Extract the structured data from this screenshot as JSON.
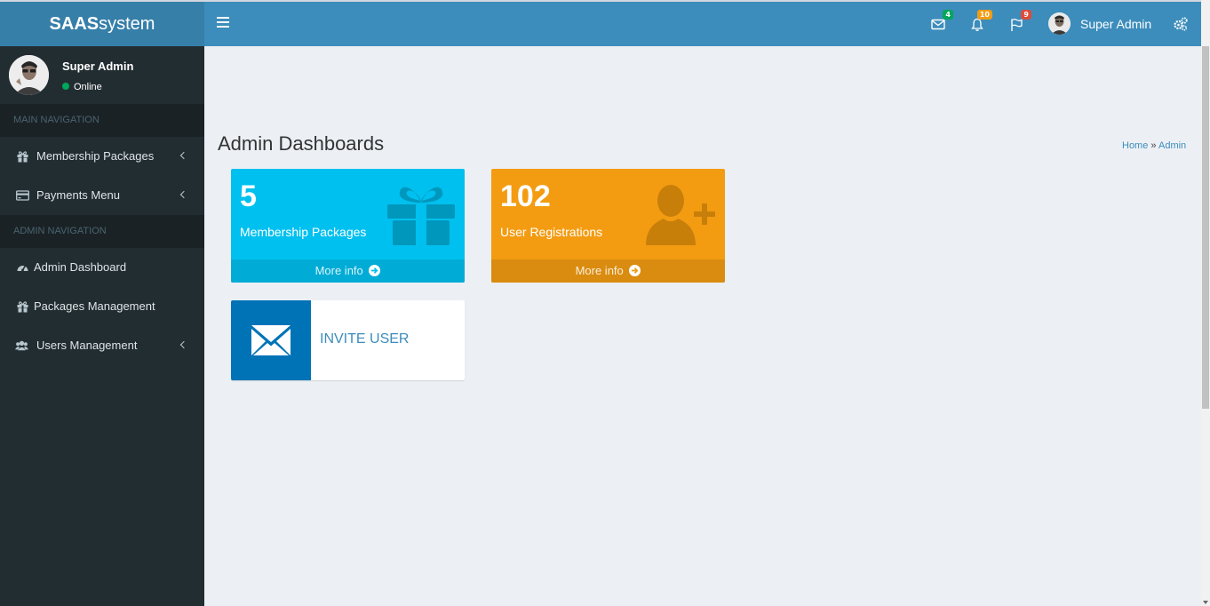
{
  "brand": {
    "bold": "SAAS",
    "rest": "system"
  },
  "navbar": {
    "notifications": [
      {
        "icon": "envelope-icon",
        "count": "4",
        "color": "#00a65a"
      },
      {
        "icon": "bell-icon",
        "count": "10",
        "color": "#f39c12"
      },
      {
        "icon": "flag-icon",
        "count": "9",
        "color": "#dd4b39"
      }
    ],
    "user_name": "Super Admin"
  },
  "sidebar": {
    "user": {
      "name": "Super Admin",
      "status": "Online"
    },
    "sections": [
      {
        "header": "MAIN NAVIGATION",
        "items": [
          {
            "icon": "gift-icon",
            "label": "Membership Packages",
            "has_submenu": true
          },
          {
            "icon": "credit-card-icon",
            "label": "Payments Menu",
            "has_submenu": true
          }
        ]
      },
      {
        "header": "ADMIN NAVIGATION",
        "items": [
          {
            "icon": "dashboard-icon",
            "label": "Admin Dashboard",
            "has_submenu": false
          },
          {
            "icon": "gift-icon",
            "label": "Packages Management",
            "has_submenu": false
          },
          {
            "icon": "users-icon",
            "label": "Users Management",
            "has_submenu": true
          }
        ]
      }
    ]
  },
  "content": {
    "title": "Admin Dashboards",
    "breadcrumb": {
      "home": "Home",
      "sep": "»",
      "current": "Admin"
    },
    "stat_boxes": [
      {
        "value": "5",
        "label": "Membership Packages",
        "footer": "More info",
        "icon": "gift-icon",
        "color": "#00c0ef"
      },
      {
        "value": "102",
        "label": "User Registrations",
        "footer": "More info",
        "icon": "user-plus-icon",
        "color": "#f39c12"
      }
    ],
    "info_box": {
      "label": "INVITE USER",
      "icon": "envelope-icon",
      "color": "#0073b7"
    }
  }
}
